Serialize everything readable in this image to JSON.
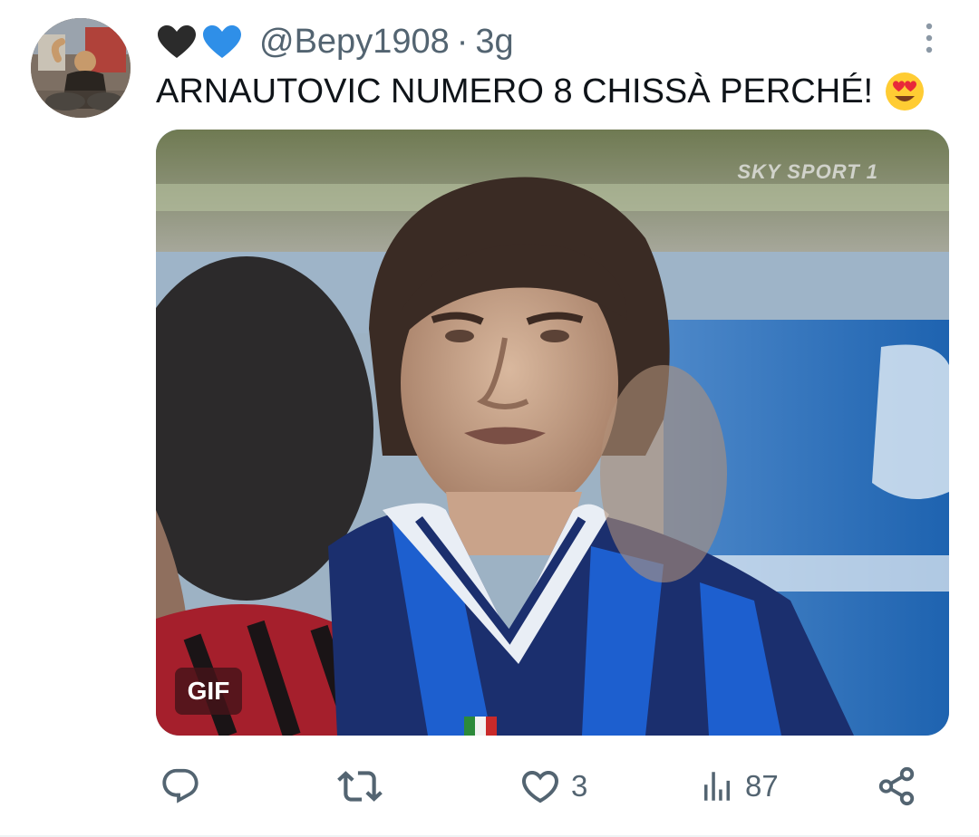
{
  "tweet": {
    "handle": "@Bepy1908",
    "separator": "·",
    "time": "3g",
    "text": "ARNAUTOVIC NUMERO 8 CHISSÀ PERCHÉ!",
    "emoji": "smiling-face-with-heart-eyes",
    "name_emojis": [
      "black-heart",
      "blue-heart"
    ]
  },
  "media": {
    "type_badge": "GIF",
    "broadcast_logo": "SKY SPORT 1"
  },
  "actions": {
    "reply": {
      "icon": "reply-icon"
    },
    "retweet": {
      "icon": "retweet-icon"
    },
    "like": {
      "icon": "heart-icon",
      "count": "3"
    },
    "views": {
      "icon": "views-icon",
      "count": "87"
    },
    "share": {
      "icon": "share-icon"
    }
  },
  "colors": {
    "secondary_text": "#536471",
    "primary_text": "#0f1419",
    "blue_heart": "#2f8fe8",
    "black_heart": "#2b2b2b"
  }
}
